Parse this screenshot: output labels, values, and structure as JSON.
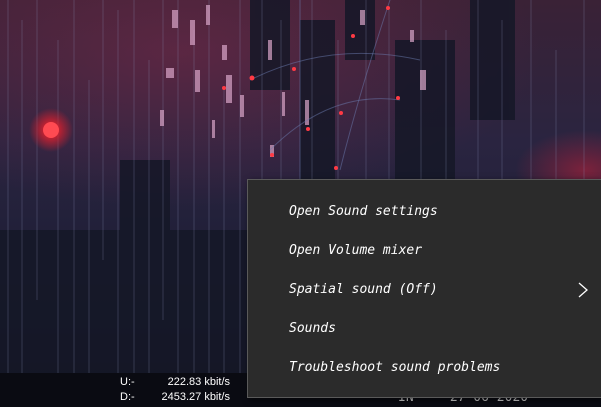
{
  "context_menu": {
    "items": [
      {
        "label": "Open Sound settings",
        "has_submenu": false
      },
      {
        "label": "Open Volume mixer",
        "has_submenu": false
      },
      {
        "label": "Spatial sound (Off)",
        "has_submenu": true
      },
      {
        "label": "Sounds",
        "has_submenu": false
      },
      {
        "label": "Troubleshoot sound problems",
        "has_submenu": false
      }
    ],
    "background": "#2b2b2b",
    "text_color": "#ffffff"
  },
  "net_speed": {
    "upload_label": "U:-",
    "upload_value": "222.83 kbit/s",
    "download_label": "D:-",
    "download_value": "2453.27 kbit/s"
  },
  "tray": {
    "language": "IN",
    "date": "27-06-2020"
  },
  "icons": {
    "submenu": "chevron-right-icon"
  },
  "colors": {
    "accent_red": "#ff2a3a"
  }
}
